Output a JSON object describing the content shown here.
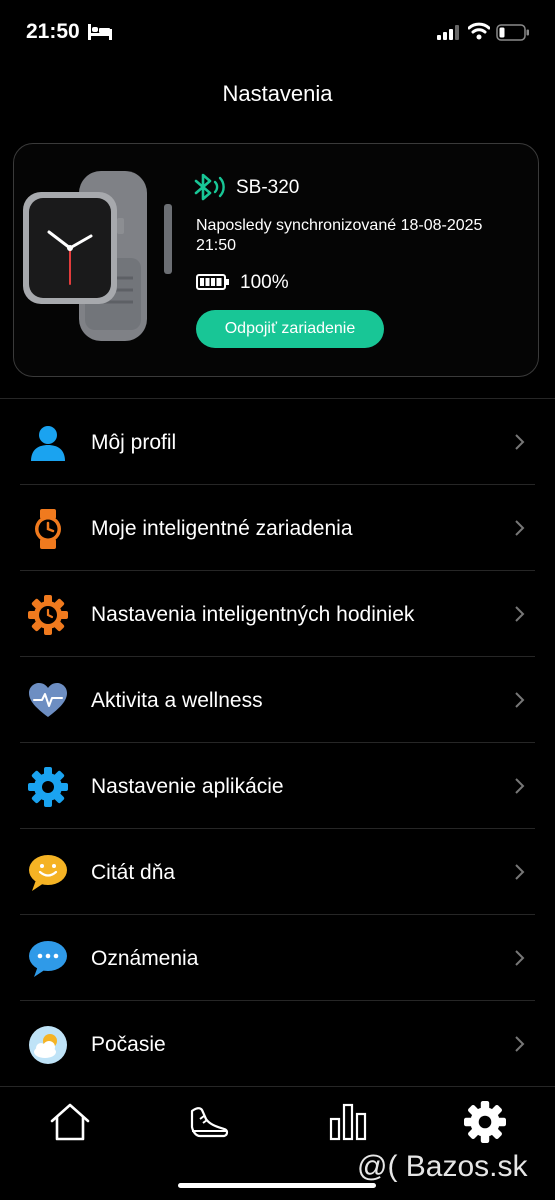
{
  "status_bar": {
    "time": "21:50"
  },
  "header": {
    "title": "Nastavenia"
  },
  "device": {
    "name": "SB-320",
    "sync_text": "Naposledy synchronizované 18-08-2025 21:50",
    "battery": "100%",
    "disconnect_label": "Odpojiť zariadenie",
    "accent_color": "#18c696"
  },
  "menu": {
    "items": [
      {
        "label": "Môj profil",
        "icon": "person-icon"
      },
      {
        "label": "Moje inteligentné zariadenia",
        "icon": "watch-icon"
      },
      {
        "label": "Nastavenia inteligentných hodiniek",
        "icon": "watch-gear-icon"
      },
      {
        "label": "Aktivita a wellness",
        "icon": "heart-pulse-icon"
      },
      {
        "label": "Nastavenie aplikácie",
        "icon": "gear-icon"
      },
      {
        "label": "Citát dňa",
        "icon": "smile-bubble-icon"
      },
      {
        "label": "Oznámenia",
        "icon": "chat-bubble-icon"
      },
      {
        "label": "Počasie",
        "icon": "weather-icon"
      }
    ]
  },
  "tabs": [
    {
      "name": "home",
      "icon": "home-icon"
    },
    {
      "name": "activity",
      "icon": "shoe-icon"
    },
    {
      "name": "stats",
      "icon": "bar-chart-icon"
    },
    {
      "name": "settings",
      "icon": "gear-icon",
      "active": true
    }
  ],
  "watermark": "@( Bazos.sk"
}
